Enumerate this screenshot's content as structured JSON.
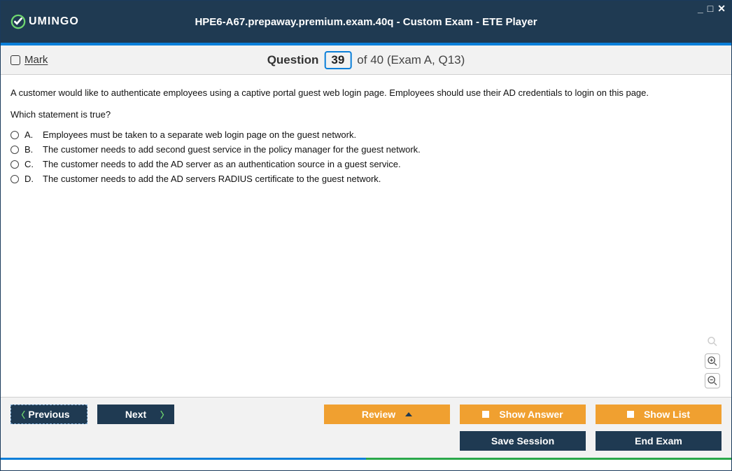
{
  "brand": {
    "name": "UMINGO"
  },
  "window": {
    "title": "HPE6-A67.prepaway.premium.exam.40q - Custom Exam - ETE Player"
  },
  "subheader": {
    "mark_label": "Mark",
    "question_word": "Question",
    "question_number": "39",
    "of_label": "of 40 (Exam A, Q13)"
  },
  "question": {
    "text": "A customer would like to authenticate employees using a captive portal guest web login page. Employees should use their AD credentials to login on this page.",
    "prompt": "Which statement is true?",
    "options": [
      {
        "letter": "A.",
        "text": "Employees must be taken to a separate web login page on the guest network."
      },
      {
        "letter": "B.",
        "text": "The customer needs to add second guest service in the policy manager for the guest network."
      },
      {
        "letter": "C.",
        "text": "The customer needs to add the AD server as an authentication source in a guest service."
      },
      {
        "letter": "D.",
        "text": "The customer needs to add the AD servers RADIUS certificate to the guest network."
      }
    ]
  },
  "buttons": {
    "previous": "Previous",
    "next": "Next",
    "review": "Review",
    "show_answer": "Show Answer",
    "show_list": "Show List",
    "save_session": "Save Session",
    "end_exam": "End Exam"
  }
}
